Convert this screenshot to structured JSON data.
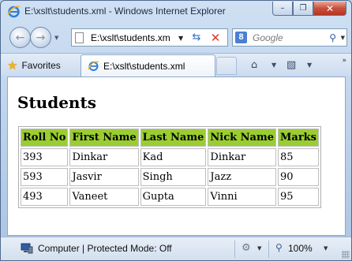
{
  "window": {
    "title": "E:\\xslt\\students.xml - Windows Internet Explorer",
    "controls": {
      "minimize": "–",
      "restore": "❐",
      "close": "✕"
    }
  },
  "navbar": {
    "back_icon": "back-arrow-icon",
    "forward_icon": "forward-arrow-icon",
    "address": "E:\\xslt\\students.xm",
    "search_placeholder": "Google",
    "search_engine_letter": "8"
  },
  "favorites_bar": {
    "favorites_label": "Favorites",
    "tab_label": "E:\\xslt\\students.xml"
  },
  "page": {
    "heading": "Students",
    "table": {
      "columns": [
        "Roll No",
        "First Name",
        "Last Name",
        "Nick Name",
        "Marks"
      ],
      "rows": [
        [
          "393",
          "Dinkar",
          "Kad",
          "Dinkar",
          "85"
        ],
        [
          "593",
          "Jasvir",
          "Singh",
          "Jazz",
          "90"
        ],
        [
          "493",
          "Vaneet",
          "Gupta",
          "Vinni",
          "95"
        ]
      ],
      "header_color": "#9acd32"
    }
  },
  "statusbar": {
    "zone_text": "Computer | Protected Mode: Off",
    "zoom": "100%"
  }
}
